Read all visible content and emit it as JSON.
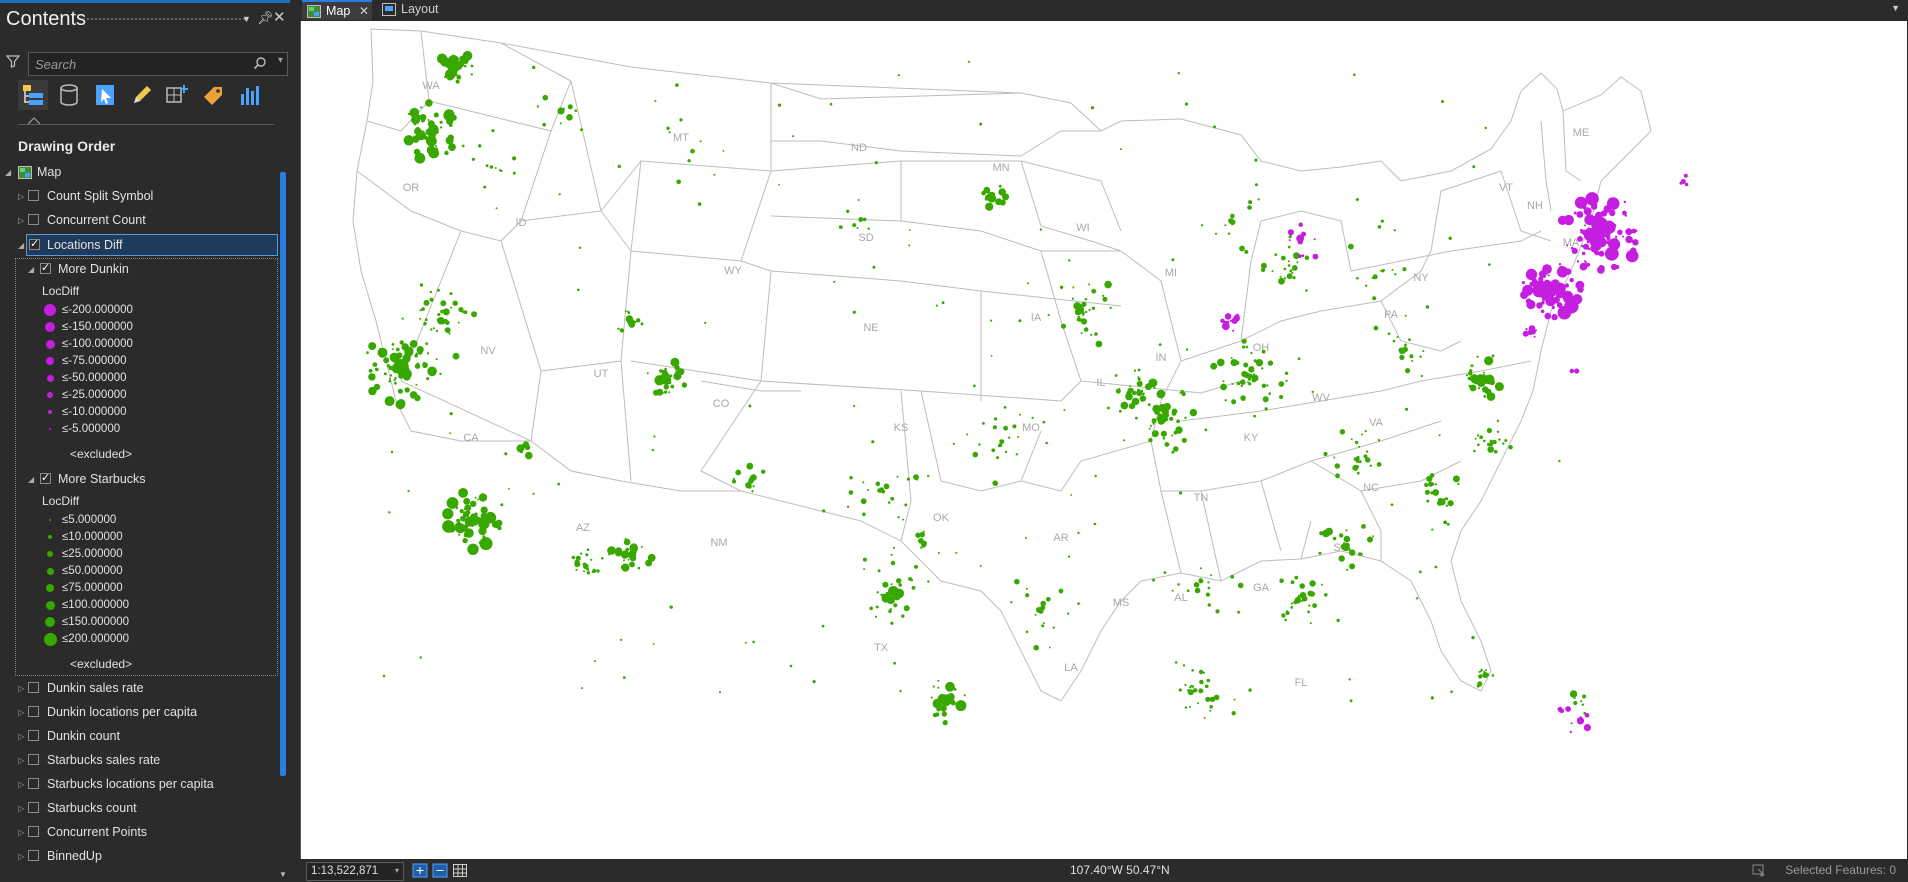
{
  "pane": {
    "title": "Contents",
    "search_placeholder": "Search",
    "drawing_order_label": "Drawing Order",
    "toolbar_icons": [
      "drawing-order-icon",
      "data-source-icon",
      "selection-icon",
      "editing-icon",
      "snapping-icon",
      "labeling-icon",
      "charts-icon"
    ]
  },
  "tree": {
    "map_label": "Map",
    "layers_top": [
      {
        "label": "Count Split Symbol",
        "checked": false
      },
      {
        "label": "Concurrent Count",
        "checked": false
      }
    ],
    "locations_diff": {
      "label": "Locations Diff",
      "checked": true
    },
    "more_dunkin": {
      "label": "More Dunkin",
      "checked": true,
      "field": "LocDiff",
      "classes": [
        "≤-200.000000",
        "≤-150.000000",
        "≤-100.000000",
        "≤-75.000000",
        "≤-50.000000",
        "≤-25.000000",
        "≤-10.000000",
        "≤-5.000000"
      ],
      "color": "#c61ee0",
      "excluded": "<excluded>"
    },
    "more_starbucks": {
      "label": "More Starbucks",
      "checked": true,
      "field": "LocDiff",
      "classes": [
        "≤5.000000",
        "≤10.000000",
        "≤25.000000",
        "≤50.000000",
        "≤75.000000",
        "≤100.000000",
        "≤150.000000",
        "≤200.000000"
      ],
      "color": "#38a800",
      "excluded": "<excluded>"
    },
    "layers_bottom": [
      {
        "label": "Dunkin sales rate",
        "checked": false
      },
      {
        "label": "Dunkin locations per capita",
        "checked": false
      },
      {
        "label": "Dunkin count",
        "checked": false
      },
      {
        "label": "Starbucks sales rate",
        "checked": false
      },
      {
        "label": "Starbucks locations per capita",
        "checked": false
      },
      {
        "label": "Starbucks count",
        "checked": false
      },
      {
        "label": "Concurrent Points",
        "checked": false
      },
      {
        "label": "BinnedUp",
        "checked": false
      }
    ]
  },
  "tabs": [
    {
      "label": "Map",
      "active": true
    },
    {
      "label": "Layout",
      "active": false
    }
  ],
  "map": {
    "state_labels": [
      "WA",
      "OR",
      "ID",
      "MT",
      "ND",
      "SD",
      "WY",
      "NE",
      "NV",
      "UT",
      "CO",
      "KS",
      "MN",
      "WI",
      "MI",
      "IA",
      "IL",
      "MO",
      "OK",
      "AR",
      "TX",
      "LA",
      "MS",
      "AL",
      "GA",
      "FL",
      "SC",
      "NC",
      "TN",
      "KY",
      "IN",
      "OH",
      "WV",
      "VA",
      "PA",
      "NY",
      "VT",
      "NH",
      "ME",
      "MA",
      "CA",
      "AZ",
      "NM"
    ],
    "colors": {
      "dunkin": "#c61ee0",
      "starbucks": "#38a800",
      "outline": "#bdbdbd"
    }
  },
  "status": {
    "scale": "1:13,522,871",
    "coordinates": "107.40°W 50.47°N",
    "selected_features": "Selected Features: 0"
  }
}
